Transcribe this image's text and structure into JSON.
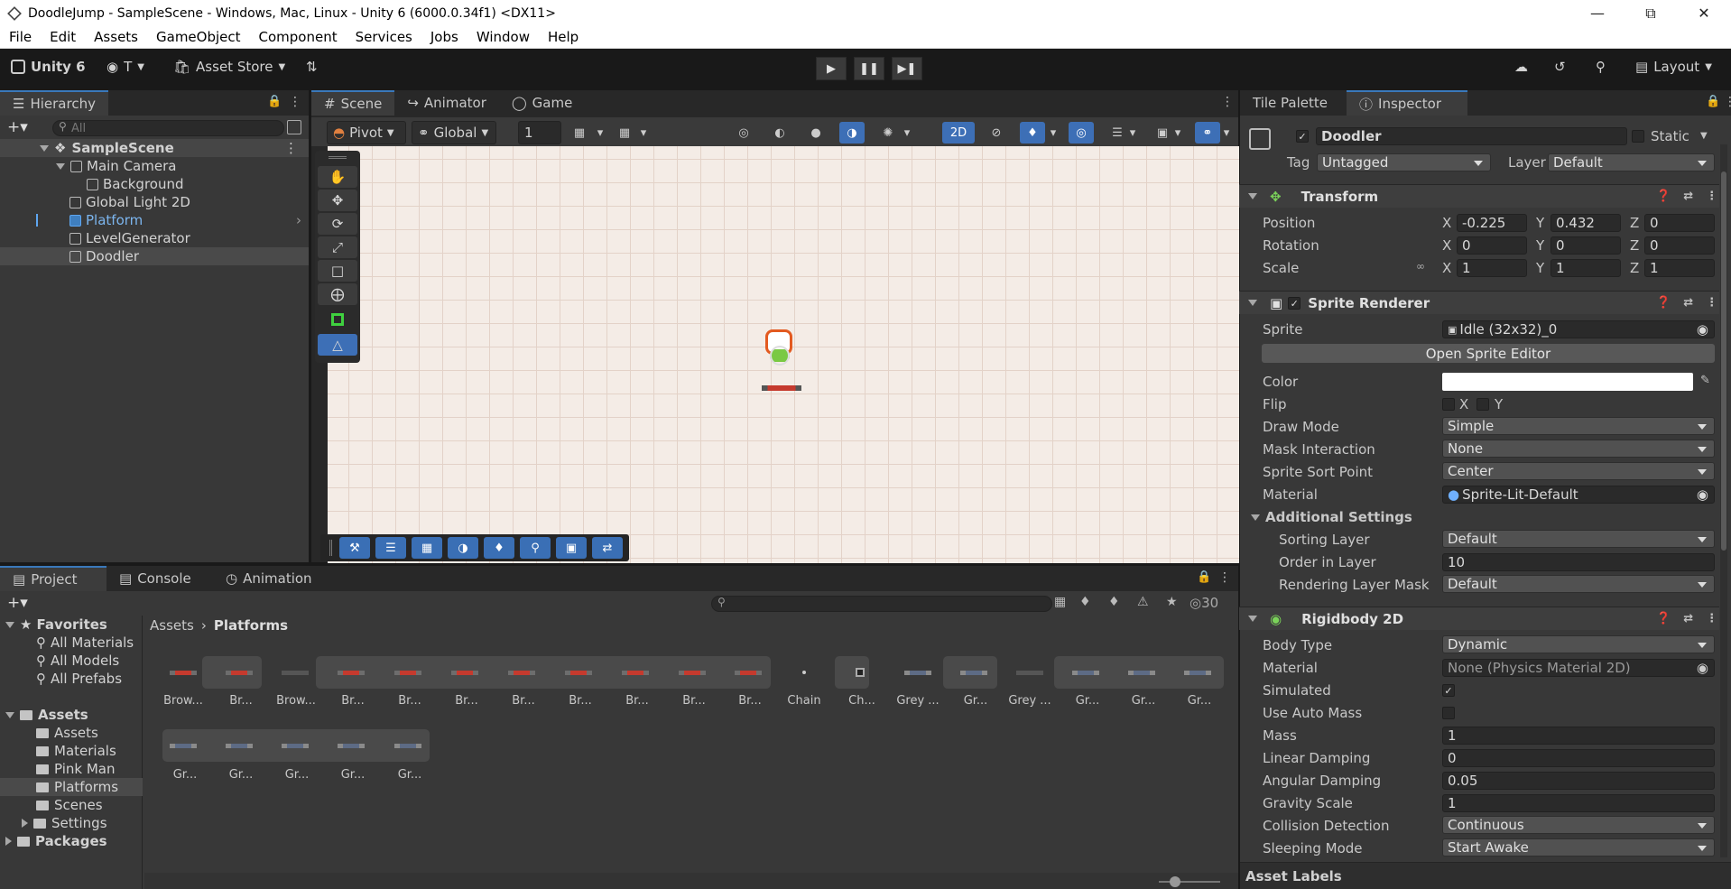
{
  "window": {
    "title": "DoodleJump - SampleScene - Windows, Mac, Linux - Unity 6 (6000.0.34f1) <DX11>"
  },
  "menu": [
    "File",
    "Edit",
    "Assets",
    "GameObject",
    "Component",
    "Services",
    "Jobs",
    "Window",
    "Help"
  ],
  "toolbar": {
    "unity": "Unity 6",
    "account": "T",
    "asset_store": "Asset Store",
    "layout": "Layout"
  },
  "hierarchy": {
    "tab": "Hierarchy",
    "search_placeholder": "All",
    "scene": "SampleScene",
    "items": [
      {
        "label": "Main Camera",
        "depth": 1,
        "expanded": true
      },
      {
        "label": "Background",
        "depth": 2
      },
      {
        "label": "Global Light 2D",
        "depth": 1
      },
      {
        "label": "Platform",
        "depth": 1,
        "prefab": true
      },
      {
        "label": "LevelGenerator",
        "depth": 1
      },
      {
        "label": "Doodler",
        "depth": 1,
        "selected": true
      }
    ]
  },
  "scene": {
    "tabs": [
      "Scene",
      "Animator",
      "Game"
    ],
    "pivot": "Pivot",
    "global": "Global",
    "snap": "1",
    "mode2d": "2D"
  },
  "project": {
    "tabs": [
      "Project",
      "Console",
      "Animation"
    ],
    "count": "30",
    "breadcrumb": [
      "Assets",
      "Platforms"
    ],
    "favorites": {
      "label": "Favorites",
      "items": [
        "All Materials",
        "All Models",
        "All Prefabs"
      ]
    },
    "assets": {
      "label": "Assets",
      "items": [
        "Assets",
        "Materials",
        "Pink Man",
        "Platforms",
        "Scenes",
        "Settings"
      ],
      "selected": "Platforms"
    },
    "packages": "Packages",
    "row1": [
      "Brow...",
      "Br...",
      "Brow...",
      "Br...",
      "Br...",
      "Br...",
      "Br...",
      "Br...",
      "Br...",
      "Br...",
      "Br...",
      "Chain",
      "Ch...",
      "Grey ...",
      "Gr...",
      "Grey ...",
      "Gr...",
      "Gr...",
      "Gr..."
    ],
    "row2": [
      "Gr...",
      "Gr...",
      "Gr...",
      "Gr...",
      "Gr..."
    ]
  },
  "inspector": {
    "tabs": [
      "Tile Palette",
      "Inspector"
    ],
    "name": "Doodler",
    "static": "Static",
    "tag_label": "Tag",
    "tag": "Untagged",
    "layer_label": "Layer",
    "layer": "Default",
    "transform": {
      "title": "Transform",
      "position_label": "Position",
      "position": {
        "x": "-0.225",
        "y": "0.432",
        "z": "0"
      },
      "rotation_label": "Rotation",
      "rotation": {
        "x": "0",
        "y": "0",
        "z": "0"
      },
      "scale_label": "Scale",
      "scale": {
        "x": "1",
        "y": "1",
        "z": "1"
      }
    },
    "sprite_renderer": {
      "title": "Sprite Renderer",
      "sprite_label": "Sprite",
      "sprite": "Idle (32x32)_0",
      "open_editor": "Open Sprite Editor",
      "color_label": "Color",
      "flip_label": "Flip",
      "flip_x": "X",
      "flip_y": "Y",
      "draw_mode_label": "Draw Mode",
      "draw_mode": "Simple",
      "mask_label": "Mask Interaction",
      "mask": "None",
      "sort_point_label": "Sprite Sort Point",
      "sort_point": "Center",
      "material_label": "Material",
      "material": "Sprite-Lit-Default",
      "additional": "Additional Settings",
      "sorting_layer_label": "Sorting Layer",
      "sorting_layer": "Default",
      "order_label": "Order in Layer",
      "order": "10",
      "rlm_label": "Rendering Layer Mask",
      "rlm": "Default"
    },
    "rigidbody": {
      "title": "Rigidbody 2D",
      "body_type_label": "Body Type",
      "body_type": "Dynamic",
      "material_label": "Material",
      "material": "None (Physics Material 2D)",
      "simulated_label": "Simulated",
      "auto_mass_label": "Use Auto Mass",
      "mass_label": "Mass",
      "mass": "1",
      "lin_damp_label": "Linear Damping",
      "lin_damp": "0",
      "ang_damp_label": "Angular Damping",
      "ang_damp": "0.05",
      "gravity_label": "Gravity Scale",
      "gravity": "1",
      "collision_label": "Collision Detection",
      "collision": "Continuous",
      "sleep_label": "Sleeping Mode",
      "sleep": "Start Awake"
    },
    "asset_labels": "Asset Labels"
  }
}
